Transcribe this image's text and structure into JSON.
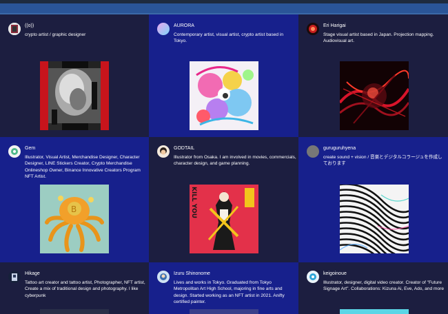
{
  "artists": [
    {
      "name": "((o))",
      "description": "crypto artist / graphic designer"
    },
    {
      "name": "AURORA",
      "description": "Contemporary artist, visual artist, crypto artist based in Tokyo."
    },
    {
      "name": "Eri Harigai",
      "description": "Stage visual artist based in Japan. Projection mapping. Audiovisual art."
    },
    {
      "name": "Gem",
      "description": "Illustrator, Visual Artist, Merchandise Designer, Character Designer, LINE Stickers Creator, Crypto Merchandise Onlineshop Owner, Binance Innovative Creators Program NFT Artist."
    },
    {
      "name": "GODTAIL",
      "description": "Illustrator from Osaka. I am involved in movies, commercials, character design, and game planning."
    },
    {
      "name": "guruguruhyena",
      "description": "create sound + vision / 音楽とデジタルコラージュを作成しております"
    },
    {
      "name": "Hikage",
      "description": "Tattoo art creator and tattoo artist, Photographer, NFT artist, Create a mix of traditional design and photography. I like cyberpunk"
    },
    {
      "name": "Izuru Shinonome",
      "description": "Lives and works in Tokyo. Graduated from Tokyo Metropolitan Art High School, majoring in fine arts and design. Started working as an NFT artist in 2021. Anifty certified painter."
    },
    {
      "name": "keigoinoue",
      "description": "Illustrator, designer, digital video creator. Creator of \"Future Signage Art\". Collaborations: Kizuna Ai, Eve, Ado, and more"
    }
  ],
  "artwork_text": {
    "godtail": "KILL YOU"
  },
  "colors": {
    "card_dark": "#1c1e40",
    "card_blue": "#17208c",
    "top_bar": "#2a5598"
  }
}
